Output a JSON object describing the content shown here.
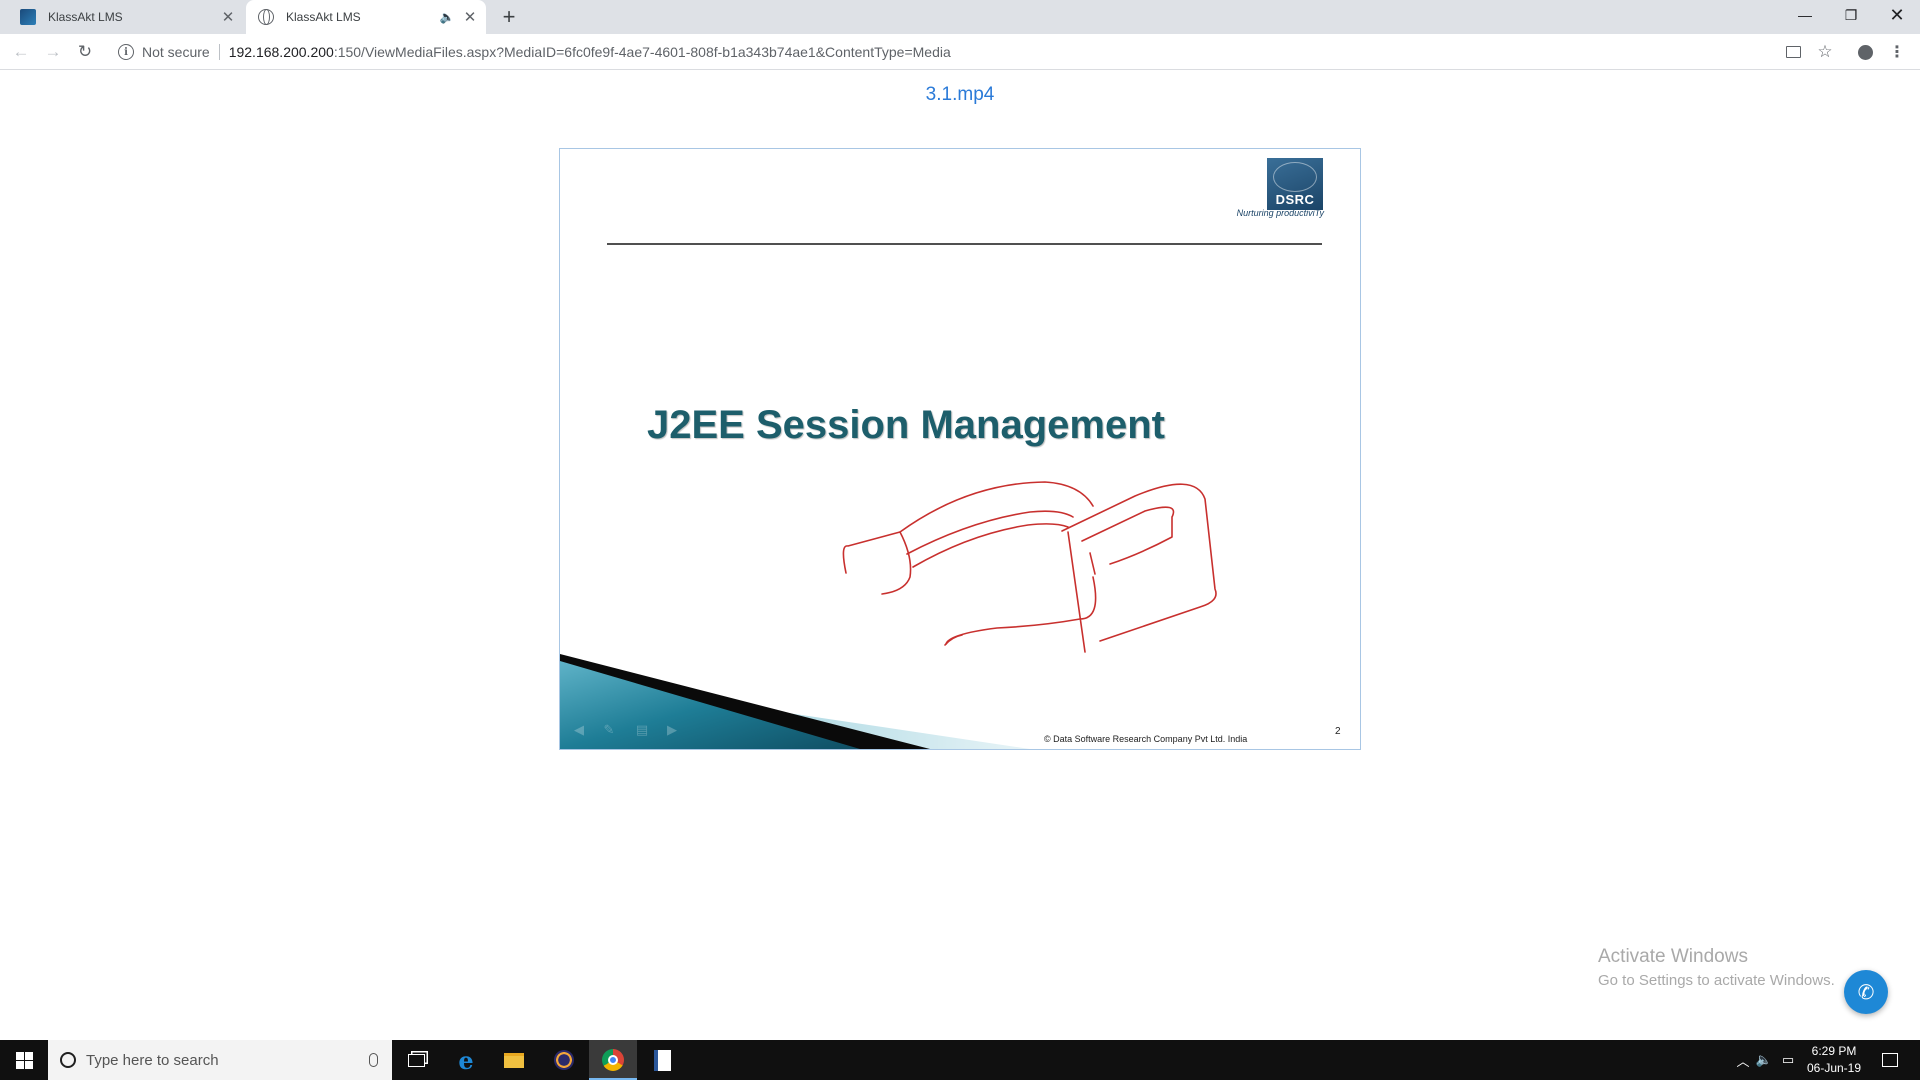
{
  "browser": {
    "tabs": [
      {
        "title": "KlassAkt LMS",
        "active": false
      },
      {
        "title": "KlassAkt LMS",
        "active": true,
        "audio": true
      }
    ],
    "address_bar": {
      "security_label": "Not secure",
      "url_host": "192.168.200.200",
      "url_rest": ":150/ViewMediaFiles.aspx?MediaID=6fc0fe9f-4ae7-4601-808f-b1a343b74ae1&ContentType=Media"
    }
  },
  "page": {
    "media_title": "3.1.mp4",
    "slide": {
      "logo_text": "DSRC",
      "tagline": "Nurturing productiviTy",
      "title": "J2EE Session Management",
      "copyright": "© Data Software Research Company Pvt Ltd. India",
      "page_number": "2",
      "annotation_color": "#c8302e",
      "title_color": "#1d5e6b"
    }
  },
  "watermark": {
    "title": "Activate Windows",
    "subtitle": "Go to Settings to activate Windows."
  },
  "taskbar": {
    "search_placeholder": "Type here to search",
    "apps": [
      "task-view",
      "edge",
      "file-explorer",
      "eclipse",
      "chrome",
      "document-viewer"
    ],
    "active_app": "chrome",
    "time": "6:29 PM",
    "date": "06-Jun-19"
  }
}
